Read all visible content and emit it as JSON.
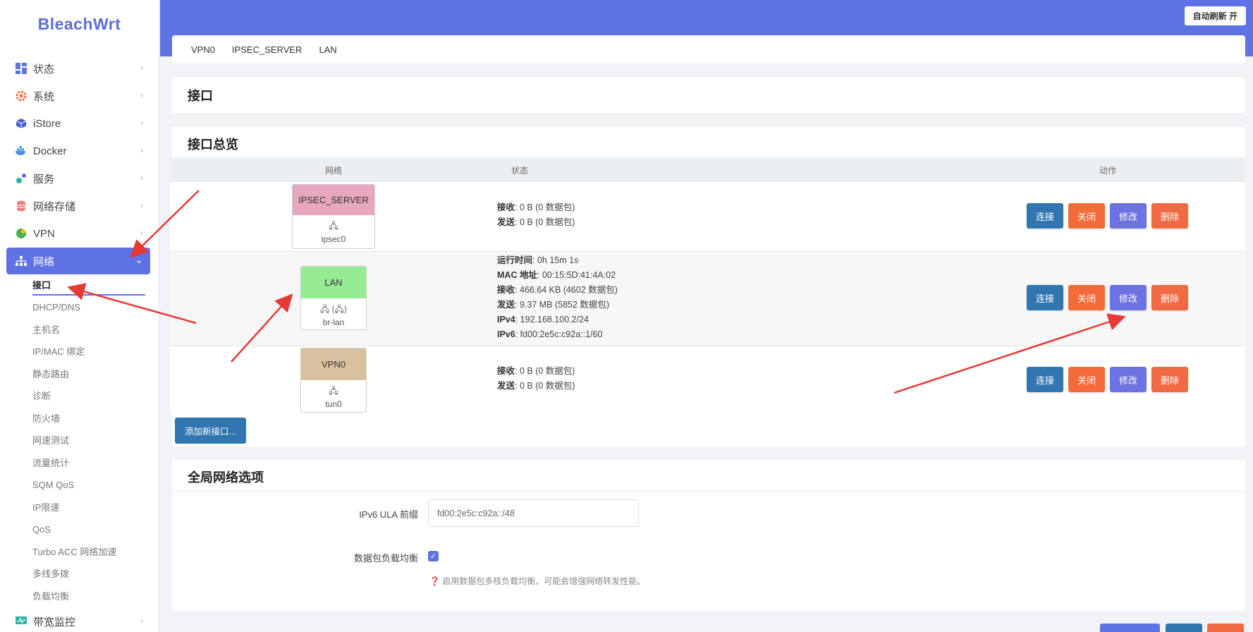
{
  "brand": "BleachWrt",
  "top": {
    "auto_refresh": "自动刷新 开"
  },
  "sidebar": {
    "items": [
      {
        "label": "状态",
        "icon": "dashboard-icon"
      },
      {
        "label": "系统",
        "icon": "gear-icon"
      },
      {
        "label": "iStore",
        "icon": "cube-icon"
      },
      {
        "label": "Docker",
        "icon": "docker-icon"
      },
      {
        "label": "服务",
        "icon": "services-icon"
      },
      {
        "label": "网络存储",
        "icon": "database-icon"
      },
      {
        "label": "VPN",
        "icon": "globe-icon"
      },
      {
        "label": "网络",
        "icon": "sitemap-icon"
      }
    ],
    "subitems": [
      "接口",
      "DHCP/DNS",
      "主机名",
      "IP/MAC 绑定",
      "静态路由",
      "诊断",
      "防火墙",
      "网速测试",
      "流量统计",
      "SQM QoS",
      "IP限速",
      "QoS",
      "Turbo ACC 网络加速",
      "多线多拨",
      "负载均衡"
    ],
    "bottom_item": {
      "label": "带宽监控",
      "icon": "monitor-icon"
    }
  },
  "tabs": [
    "VPN0",
    "IPSEC_SERVER",
    "LAN"
  ],
  "page_title": "接口",
  "overview": {
    "title": "接口总览",
    "headers": {
      "network": "网络",
      "status": "状态",
      "actions": "动作"
    },
    "rows": [
      {
        "name": "IPSEC_SERVER",
        "color": "#e8a7c1",
        "device": "ipsec0",
        "device_icon": "🖧",
        "status": [
          {
            "label": "接收",
            "value": ": 0 B (0 数据包)"
          },
          {
            "label": "发送",
            "value": ": 0 B (0 数据包)"
          }
        ]
      },
      {
        "name": "LAN",
        "color": "#95ec95",
        "device": "br-lan",
        "device_icon": "🖧 (🖧)",
        "status": [
          {
            "label": "运行时间",
            "value": ": 0h 15m 1s"
          },
          {
            "label": "MAC 地址",
            "value": ": 00:15:5D:41:4A:02"
          },
          {
            "label": "接收",
            "value": ": 466.64 KB (4602 数据包)"
          },
          {
            "label": "发送",
            "value": ": 9.37 MB (5852 数据包)"
          },
          {
            "label": "IPv4",
            "value": ": 192.168.100.2/24"
          },
          {
            "label": "IPv6",
            "value": ": fd00:2e5c:c92a::1/60"
          }
        ]
      },
      {
        "name": "VPN0",
        "color": "#d9c19f",
        "device": "tun0",
        "device_icon": "🖧",
        "status": [
          {
            "label": "接收",
            "value": ": 0 B (0 数据包)"
          },
          {
            "label": "发送",
            "value": ": 0 B (0 数据包)"
          }
        ]
      }
    ],
    "buttons": {
      "connect": "连接",
      "close": "关闭",
      "edit": "修改",
      "delete": "删除"
    },
    "add_button": "添加新接口..."
  },
  "global": {
    "title": "全局网络选项",
    "ula_label": "IPv6 ULA 前缀",
    "ula_value": "fd00:2e5c:c92a::/48",
    "balance_label": "数据包负载均衡",
    "balance_checked": true,
    "hint": "启用数据包多核负载均衡。可能会增强网络转发性能。"
  },
  "colors": {
    "accent": "#5e72e4",
    "connect": "#3276b1",
    "close": "#f46b3a",
    "edit": "#6c72e0",
    "arrow": "#e53935"
  }
}
